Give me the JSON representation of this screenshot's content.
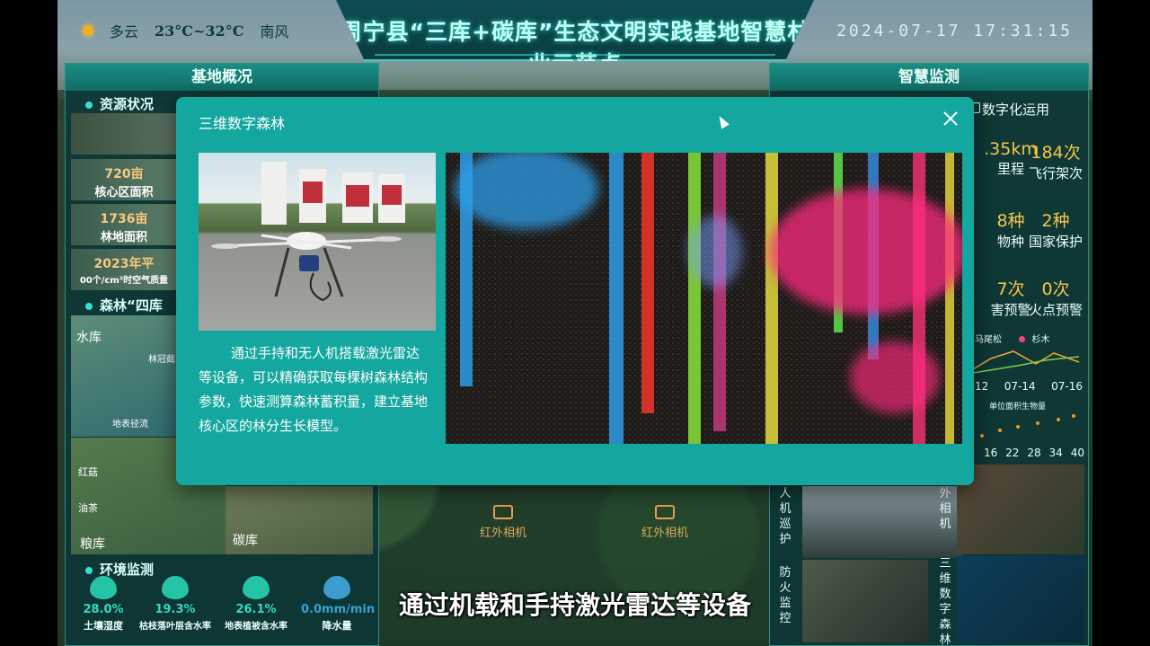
{
  "header": {
    "weather": {
      "condition": "多云",
      "temperature": "23°C~32°C",
      "wind": "南风"
    },
    "title": "周宁县“三库+碳库”生态文明实践基地智慧林业示范点",
    "datetime": "2024-07-17  17:31:15"
  },
  "left_panel": {
    "title": "基地概况",
    "resource_section": "资源状况",
    "stats": [
      {
        "value": "720亩",
        "label": "核心区面积"
      },
      {
        "value": "1736亩",
        "label": "林地面积"
      },
      {
        "value": "2023年平",
        "label": "00个/cm³时空气质量"
      }
    ],
    "forest_section": "森林“四库",
    "forest_labels": [
      "水库",
      "林冠截",
      "地表径流",
      "红菇",
      "油茶",
      "粮库",
      "碳库"
    ],
    "env_section": "环境监测",
    "env_items": [
      {
        "value": "28.0%",
        "label": "土壤湿度"
      },
      {
        "value": "19.3%",
        "label": "枯枝落叶层含水率"
      },
      {
        "value": "26.1%",
        "label": "地表植被含水率"
      },
      {
        "value": "0.0mm/min",
        "label": "降水量"
      }
    ]
  },
  "right_panel": {
    "title": "智慧监测",
    "digital_label": "数字化运用",
    "stats": [
      {
        "value": ".35km",
        "label": "里程"
      },
      {
        "value": "184次",
        "label": "飞行架次"
      },
      {
        "value": "8种",
        "label": "物种"
      },
      {
        "value": "2种",
        "label": "国家保护"
      },
      {
        "value": "7次",
        "label": "害预警"
      },
      {
        "value": "0次",
        "label": "火点预警"
      }
    ],
    "legend": [
      "马尾松",
      "杉木"
    ],
    "chart1_x": [
      "12",
      "07-14",
      "07-16"
    ],
    "chart2_label": "单位面积生物量",
    "chart2_x": [
      "16",
      "22",
      "28",
      "34",
      "40"
    ],
    "vertical_labels": [
      "人机巡护",
      "外相机",
      "防火监控",
      "三维数字森林"
    ]
  },
  "map": {
    "camera_labels": [
      "红外相机",
      "红外相机"
    ]
  },
  "modal": {
    "title": "三维数字森林",
    "description": "通过手持和无人机搭载激光雷达等设备，可以精确获取每棵树森林结构参数，快速测算森林蓄积量，建立基地核心区的林分生长模型。",
    "colors": {
      "background": "#13a79f",
      "text": "#ffffff"
    }
  },
  "subtitle": "通过机载和手持激光雷达等设备"
}
